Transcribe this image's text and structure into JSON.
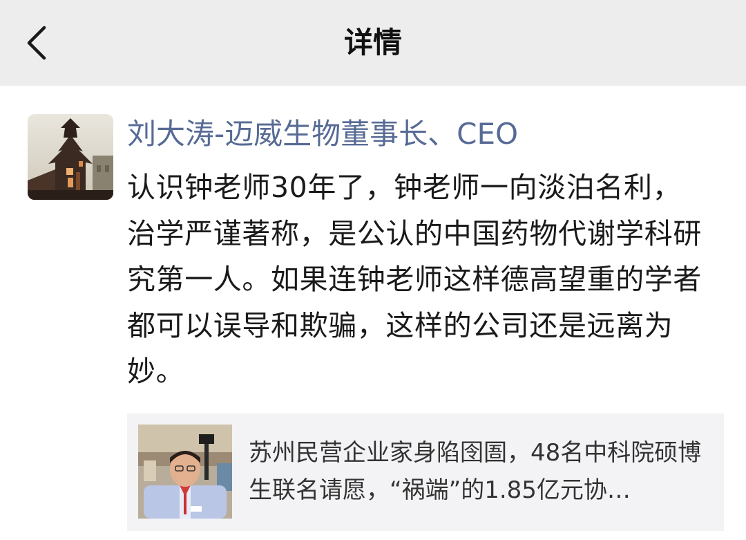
{
  "header": {
    "title": "详情",
    "back_icon": "chevron-left-icon"
  },
  "post": {
    "author": "刘大涛-迈威生物董事长、CEO",
    "author_color": "#576b95",
    "content": "认识钟老师30年了，钟老师一向淡泊名利，治学严谨著称，是公认的中国药物代谢学科研究第一人。如果连钟老师这样德高望重的学者都可以误导和欺骗，这样的公司还是远离为妙。",
    "shared_link": {
      "title": "苏州民营企业家身陷囹圄，48名中科院硕博生联名请愿，“祸端”的1.85亿元协…"
    }
  },
  "colors": {
    "navbar_bg": "#ededed",
    "card_bg": "#f3f3f5"
  }
}
